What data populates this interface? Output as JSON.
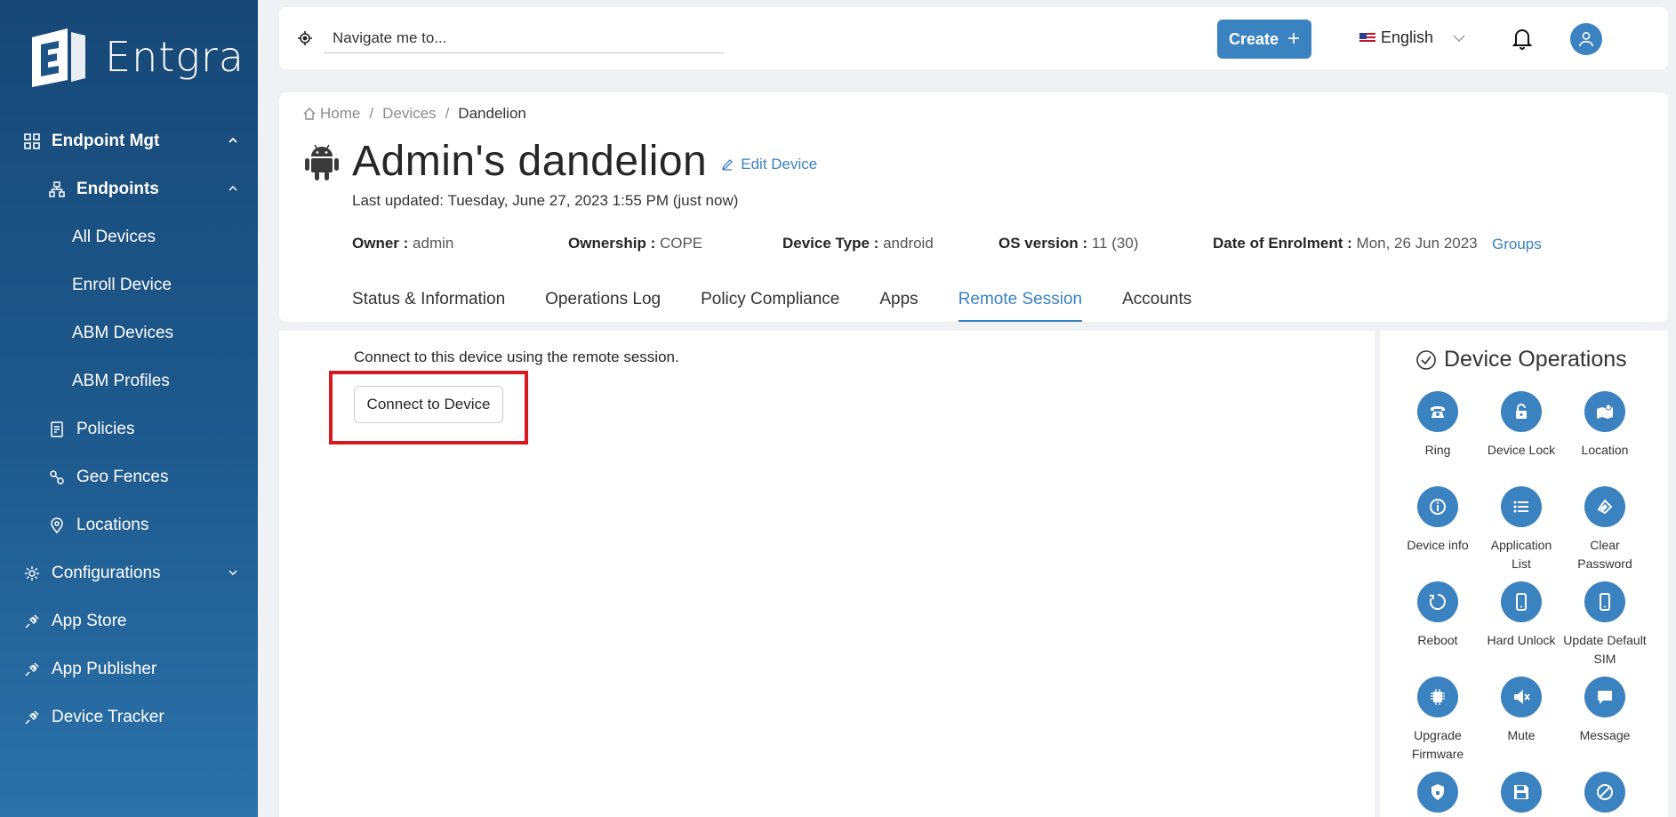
{
  "app": {
    "brand": "Entgra"
  },
  "sidebar": {
    "items": [
      {
        "label": "Endpoint Mgt"
      },
      {
        "label": "Endpoints"
      },
      {
        "label": "All Devices"
      },
      {
        "label": "Enroll Device"
      },
      {
        "label": "ABM Devices"
      },
      {
        "label": "ABM Profiles"
      },
      {
        "label": "Policies"
      },
      {
        "label": "Geo Fences"
      },
      {
        "label": "Locations"
      },
      {
        "label": "Configurations"
      },
      {
        "label": "App Store"
      },
      {
        "label": "App Publisher"
      },
      {
        "label": "Device Tracker"
      }
    ]
  },
  "topbar": {
    "search_placeholder": "Navigate me to...",
    "create_label": "Create",
    "language": "English"
  },
  "breadcrumb": {
    "home": "Home",
    "devices": "Devices",
    "current": "Dandelion"
  },
  "device": {
    "title": "Admin's dandelion",
    "edit_label": "Edit Device",
    "last_updated": "Last updated: Tuesday, June 27, 2023 1:55 PM (just now)",
    "owner_label": "Owner :",
    "owner": "admin",
    "ownership_label": "Ownership :",
    "ownership": "COPE",
    "type_label": "Device Type :",
    "type": "android",
    "os_label": "OS version :",
    "os": "11 (30)",
    "enrol_label": "Date of Enrolment :",
    "enrol": "Mon, 26 Jun 2023",
    "groups_label": "Groups"
  },
  "tabs": [
    {
      "label": "Status & Information"
    },
    {
      "label": "Operations Log"
    },
    {
      "label": "Policy Compliance"
    },
    {
      "label": "Apps"
    },
    {
      "label": "Remote Session"
    },
    {
      "label": "Accounts"
    }
  ],
  "active_tab": "Remote Session",
  "remote": {
    "description": "Connect to this device using the remote session.",
    "button_label": "Connect to Device"
  },
  "operations": {
    "title": "Device Operations",
    "items": [
      {
        "label": "Ring",
        "icon": "phone-icon"
      },
      {
        "label": "Device Lock",
        "icon": "lock-icon"
      },
      {
        "label": "Location",
        "icon": "map-icon"
      },
      {
        "label": "Device info",
        "icon": "info-icon"
      },
      {
        "label": "Application List",
        "icon": "list-icon"
      },
      {
        "label": "Clear Password",
        "icon": "eraser-icon"
      },
      {
        "label": "Reboot",
        "icon": "reboot-icon"
      },
      {
        "label": "Hard Unlock",
        "icon": "mobile-icon"
      },
      {
        "label": "Update Default SIM",
        "icon": "mobile-icon"
      },
      {
        "label": "Upgrade Firmware",
        "icon": "chip-icon"
      },
      {
        "label": "Mute",
        "icon": "mute-icon"
      },
      {
        "label": "Message",
        "icon": "message-icon"
      },
      {
        "label": "",
        "icon": "shield-icon"
      },
      {
        "label": "",
        "icon": "save-icon"
      },
      {
        "label": "",
        "icon": "block-icon"
      }
    ]
  },
  "colors": {
    "accent": "#3b82c0",
    "sidebar": "#1e5a8e",
    "highlight": "#d71920"
  }
}
